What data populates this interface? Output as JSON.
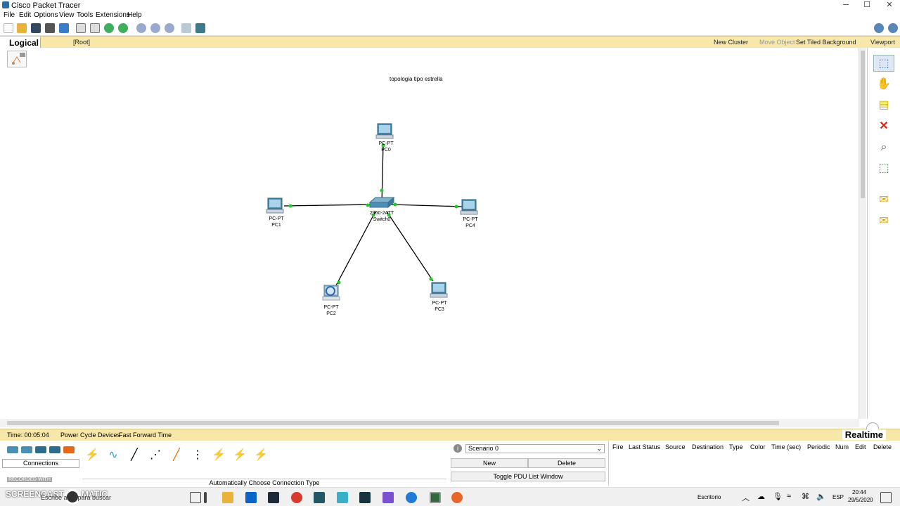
{
  "window": {
    "title": "Cisco Packet Tracer",
    "controls": {
      "minimize": "─",
      "maximize": "☐",
      "close": "✕"
    }
  },
  "menu": [
    "File",
    "Edit",
    "Options",
    "View",
    "Tools",
    "Extensions",
    "Help"
  ],
  "logicalbar": {
    "tab": "Logical",
    "root": "[Root]",
    "new_cluster": "New Cluster",
    "move_object": "Move Object",
    "set_tiled_background": "Set Tiled Background",
    "viewport": "Viewport"
  },
  "canvas": {
    "note": "topologia tipo estrella",
    "switch": {
      "model": "2960-24TT",
      "name": "Switch0"
    },
    "devices": [
      {
        "model": "PC-PT",
        "name": "PC0"
      },
      {
        "model": "PC-PT",
        "name": "PC1"
      },
      {
        "model": "PC-PT",
        "name": "PC4"
      },
      {
        "model": "PC-PT",
        "name": "PC2"
      },
      {
        "model": "PC-PT",
        "name": "PC3"
      }
    ]
  },
  "statusbar": {
    "time": "Time: 00:05:04",
    "power_cycle": "Power Cycle Devices",
    "fast_forward": "Fast Forward Time",
    "mode": "Realtime"
  },
  "bottom": {
    "connections_label": "Connections",
    "connection_hint": "Automatically Choose Connection Type",
    "scenario": "Scenario 0",
    "new_btn": "New",
    "delete_btn": "Delete",
    "toggle_pdu": "Toggle PDU List Window",
    "pdu_columns": [
      "Fire",
      "Last Status",
      "Source",
      "Destination",
      "Type",
      "Color",
      "Time (sec)",
      "Periodic",
      "Num",
      "Edit",
      "Delete"
    ]
  },
  "watermark": {
    "line1": "RECORDED WITH",
    "line2": "SCREENCAST",
    "line3": "MATIC"
  },
  "taskbar": {
    "search_placeholder": "Escribe aquí para buscar",
    "desktop_label": "Escritorio",
    "lang": "ESP",
    "clock_time": "20:44",
    "clock_date": "29/5/2020"
  },
  "colors": {
    "accent_bar": "#f7e7a8",
    "link_green": "#22cc22",
    "pc_blue": "#4a8fb4"
  }
}
